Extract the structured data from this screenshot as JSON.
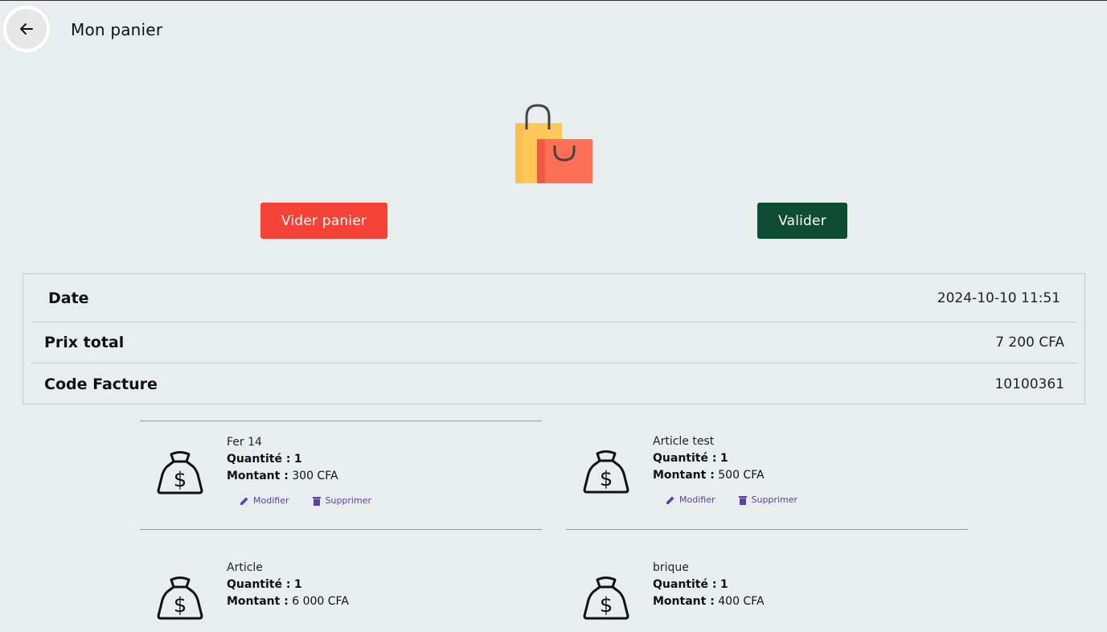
{
  "header": {
    "title": "Mon panier"
  },
  "icons": {
    "back": "arrow-left-icon",
    "illustration": "shopping-bags-icon",
    "item": "money-bag-icon",
    "edit": "pencil-icon",
    "delete": "trash-icon"
  },
  "colors": {
    "clear_button": "#f44336",
    "validate_button": "#0e4c34",
    "action_text": "#5d3fa6",
    "background": "#e8eeee"
  },
  "actions": {
    "clear_label": "Vider panier",
    "validate_label": "Valider"
  },
  "summary": {
    "date_label": "Date",
    "date_value": "2024-10-10 11:51",
    "total_label": "Prix total",
    "total_value": "7 200 CFA",
    "invoice_label": "Code Facture",
    "invoice_value": "10100361"
  },
  "item_labels": {
    "quantity": "Quantité :",
    "amount": "Montant :",
    "edit": "Modifier",
    "delete": "Supprimer"
  },
  "items": [
    {
      "name": "Fer 14",
      "quantity": "1",
      "amount": "300 CFA"
    },
    {
      "name": "Article test",
      "quantity": "1",
      "amount": "500 CFA"
    },
    {
      "name": "Article",
      "quantity": "1",
      "amount": "6 000 CFA"
    },
    {
      "name": "brique",
      "quantity": "1",
      "amount": "400 CFA"
    }
  ]
}
